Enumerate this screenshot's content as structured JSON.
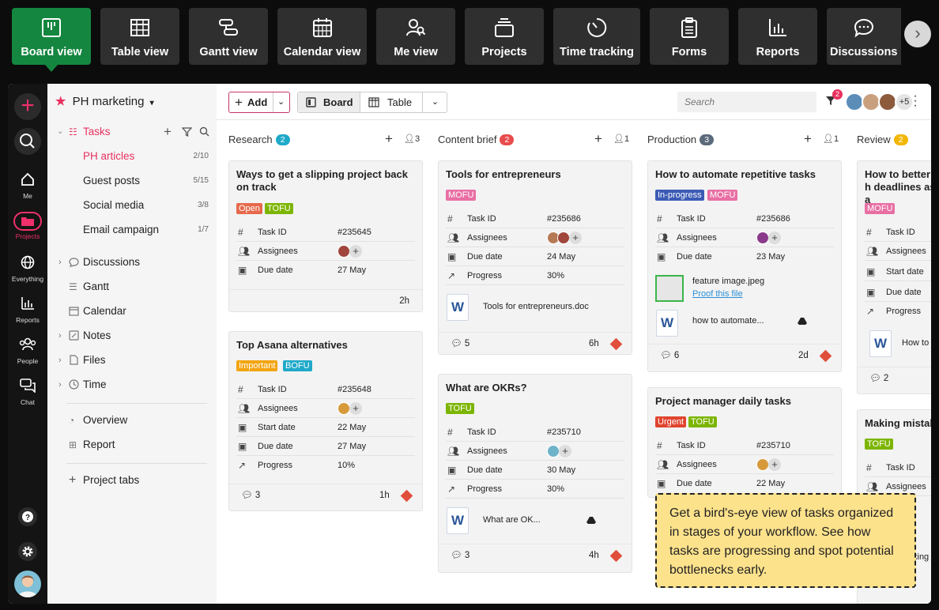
{
  "view_tabs": [
    {
      "label": "Board view",
      "icon": "board-icon"
    },
    {
      "label": "Table view",
      "icon": "table-icon"
    },
    {
      "label": "Gantt view",
      "icon": "gantt-icon"
    },
    {
      "label": "Calendar view",
      "icon": "calendar-icon"
    },
    {
      "label": "Me view",
      "icon": "me-icon"
    },
    {
      "label": "Projects",
      "icon": "projects-icon"
    },
    {
      "label": "Time tracking",
      "icon": "timer-icon"
    },
    {
      "label": "Forms",
      "icon": "clipboard-icon"
    },
    {
      "label": "Reports",
      "icon": "bar-chart-icon"
    },
    {
      "label": "Discussions",
      "icon": "speech-bubble-icon"
    }
  ],
  "rail": {
    "items": [
      {
        "label": "Me",
        "icon": "home-icon"
      },
      {
        "label": "Projects",
        "icon": "folder-icon"
      },
      {
        "label": "Everything",
        "icon": "globe-icon"
      },
      {
        "label": "Reports",
        "icon": "bar-chart-icon"
      },
      {
        "label": "People",
        "icon": "people-icon"
      },
      {
        "label": "Chat",
        "icon": "chat-icon"
      }
    ]
  },
  "sidebar": {
    "project_name": "PH marketing",
    "tasks_label": "Tasks",
    "lists": [
      {
        "label": "PH articles",
        "count": "2/10"
      },
      {
        "label": "Guest posts",
        "count": "5/15"
      },
      {
        "label": "Social media",
        "count": "3/8"
      },
      {
        "label": "Email campaign",
        "count": "1/7"
      }
    ],
    "sections": [
      {
        "label": "Discussions"
      },
      {
        "label": "Gantt"
      },
      {
        "label": "Calendar"
      },
      {
        "label": "Notes"
      },
      {
        "label": "Files"
      },
      {
        "label": "Time"
      }
    ],
    "overview": "Overview",
    "report": "Report",
    "project_tabs": "Project tabs"
  },
  "toolbar": {
    "add_label": "Add",
    "board_label": "Board",
    "table_label": "Table",
    "search_placeholder": "Search",
    "filter_badge": "2",
    "more_members": "+5"
  },
  "columns": [
    {
      "name": "Research",
      "count": "2",
      "count_color": "#1fa9c9",
      "members": "3",
      "cards": [
        {
          "title": "Ways to get a slipping project back on track",
          "tags": [
            {
              "label": "Open",
              "color": "#e7694b"
            },
            {
              "label": "TOFU",
              "color": "#7cb500"
            }
          ],
          "fields": [
            {
              "label": "Task ID",
              "value": "#235645"
            },
            {
              "label": "Assignees",
              "value": ""
            },
            {
              "label": "Due date",
              "value": "27 May"
            }
          ],
          "comments": "",
          "time": "2h"
        },
        {
          "title": "Top Asana alternatives",
          "tags": [
            {
              "label": "Important",
              "color": "#f2a411"
            },
            {
              "label": "BOFU",
              "color": "#1fa9c9"
            }
          ],
          "fields": [
            {
              "label": "Task ID",
              "value": "#235648"
            },
            {
              "label": "Assignees",
              "value": ""
            },
            {
              "label": "Start date",
              "value": "22 May"
            },
            {
              "label": "Due date",
              "value": "27 May"
            },
            {
              "label": "Progress",
              "value": "10%"
            }
          ],
          "comments": "3",
          "time": "1h"
        }
      ]
    },
    {
      "name": "Content brief",
      "count": "2",
      "count_color": "#e84c4c",
      "members": "1",
      "cards": [
        {
          "title": "Tools for entrepreneurs",
          "tags": [
            {
              "label": "MOFU",
              "color": "#e86fa4"
            }
          ],
          "fields": [
            {
              "label": "Task ID",
              "value": "#235686"
            },
            {
              "label": "Assignees",
              "value": ""
            },
            {
              "label": "Due date",
              "value": "24 May"
            },
            {
              "label": "Progress",
              "value": "30%"
            }
          ],
          "file": "Tools for entrepreneurs.doc",
          "comments": "5",
          "time": "6h"
        },
        {
          "title": "What are OKRs?",
          "tags": [
            {
              "label": "TOFU",
              "color": "#7cb500"
            }
          ],
          "fields": [
            {
              "label": "Task ID",
              "value": "#235710"
            },
            {
              "label": "Assignees",
              "value": ""
            },
            {
              "label": "Due date",
              "value": "30 May"
            },
            {
              "label": "Progress",
              "value": "30%"
            }
          ],
          "file": "What are OK...",
          "comments": "3",
          "time": "4h"
        }
      ]
    },
    {
      "name": "Production",
      "count": "3",
      "count_color": "#5b6b7b",
      "members": "1",
      "cards": [
        {
          "title": "How to automate repetitive tasks",
          "tags": [
            {
              "label": "In-progress",
              "color": "#3b5bb5"
            },
            {
              "label": "MOFU",
              "color": "#e86fa4"
            }
          ],
          "fields": [
            {
              "label": "Task ID",
              "value": "#235686"
            },
            {
              "label": "Assignees",
              "value": ""
            },
            {
              "label": "Due date",
              "value": "23 May"
            }
          ],
          "image_file": "feature image.jpeg",
          "proof_link": "Proof this file",
          "file": "how to automate...",
          "comments": "6",
          "time": "2d"
        },
        {
          "title": "Project manager daily tasks",
          "tags": [
            {
              "label": "Urgent",
              "color": "#e0442f"
            },
            {
              "label": "TOFU",
              "color": "#7cb500"
            }
          ],
          "fields": [
            {
              "label": "Task ID",
              "value": "#235710"
            },
            {
              "label": "Assignees",
              "value": ""
            },
            {
              "label": "Due date",
              "value": "22 May"
            }
          ]
        }
      ]
    },
    {
      "name": "Review",
      "count": "2",
      "count_color": "#f2b705",
      "cards": [
        {
          "title": "How to better h deadlines as a",
          "tags": [
            {
              "label": "MOFU",
              "color": "#e86fa4"
            }
          ],
          "fields": [
            {
              "label": "Task ID",
              "value": ""
            },
            {
              "label": "Assignees",
              "value": ""
            },
            {
              "label": "Start date",
              "value": ""
            },
            {
              "label": "Due date",
              "value": ""
            },
            {
              "label": "Progress",
              "value": ""
            }
          ],
          "file": "How to",
          "comments": "2"
        },
        {
          "title": "Making mistak",
          "tags": [
            {
              "label": "TOFU",
              "color": "#7cb500"
            }
          ],
          "fields": [
            {
              "label": "Task ID",
              "value": ""
            },
            {
              "label": "Assignees",
              "value": ""
            }
          ],
          "partial_text": "king"
        }
      ]
    }
  ],
  "tooltip": "Get a bird's-eye view of tasks organized in stages of your workflow. See how tasks are progressing and spot potential bottlenecks early."
}
